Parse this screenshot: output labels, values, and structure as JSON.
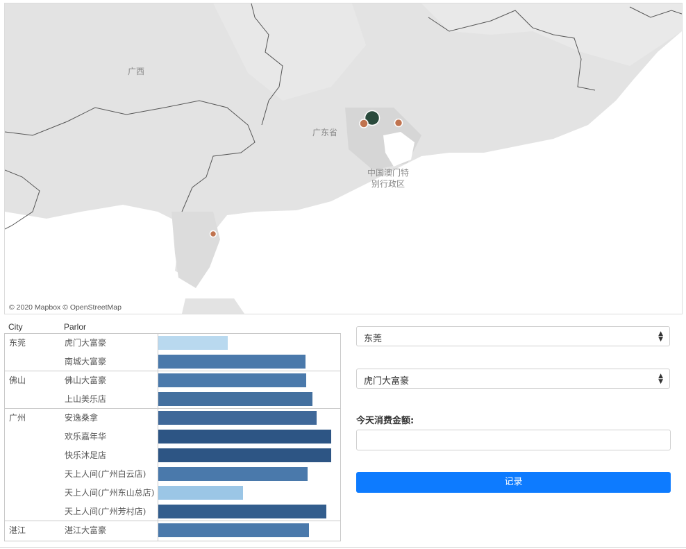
{
  "map": {
    "labels": {
      "guangxi": "广西",
      "guangdong": "广东省",
      "hk_line1": "中国澳门特",
      "hk_line2": "别行政区"
    },
    "attribution": "© 2020 Mapbox © OpenStreetMap",
    "markers": [
      {
        "name": "dongguan-marker",
        "color": "#2a4a3c"
      },
      {
        "name": "foshan-marker",
        "color": "#c0734f"
      },
      {
        "name": "huizhou-marker",
        "color": "#c0734f"
      },
      {
        "name": "zhanjiang-marker",
        "color": "#c0734f"
      }
    ]
  },
  "table": {
    "headers": {
      "city": "City",
      "parlor": "Parlor"
    },
    "rows": [
      {
        "city": "东莞",
        "parlor": "虎门大富豪",
        "value": 0.4,
        "color": "#b9d9ef"
      },
      {
        "city": "",
        "parlor": "南城大富豪",
        "value": 0.85,
        "color": "#4a79ab"
      },
      {
        "city": "佛山",
        "parlor": "佛山大富豪",
        "value": 0.855,
        "color": "#4a79ab"
      },
      {
        "city": "",
        "parlor": "上山美乐店",
        "value": 0.89,
        "color": "#44709f"
      },
      {
        "city": "广州",
        "parlor": "安逸桑拿",
        "value": 0.915,
        "color": "#3f6899"
      },
      {
        "city": "",
        "parlor": "欢乐嘉年华",
        "value": 1.0,
        "color": "#2d5584"
      },
      {
        "city": "",
        "parlor": "快乐沐足店",
        "value": 1.0,
        "color": "#2d5584"
      },
      {
        "city": "",
        "parlor": "天上人间(广州白云店)",
        "value": 0.865,
        "color": "#4a79ab"
      },
      {
        "city": "",
        "parlor": "天上人间(广州东山总店)",
        "value": 0.49,
        "color": "#9bc6e6"
      },
      {
        "city": "",
        "parlor": "天上人间(广州芳村店)",
        "value": 0.97,
        "color": "#325d8d"
      },
      {
        "city": "湛江",
        "parlor": "湛江大富豪",
        "value": 0.87,
        "color": "#4a79ab"
      }
    ]
  },
  "form": {
    "city_select": "东莞",
    "parlor_select": "虎门大富豪",
    "amount_label": "今天消费金额:",
    "amount_value": "",
    "submit_label": "记录"
  }
}
